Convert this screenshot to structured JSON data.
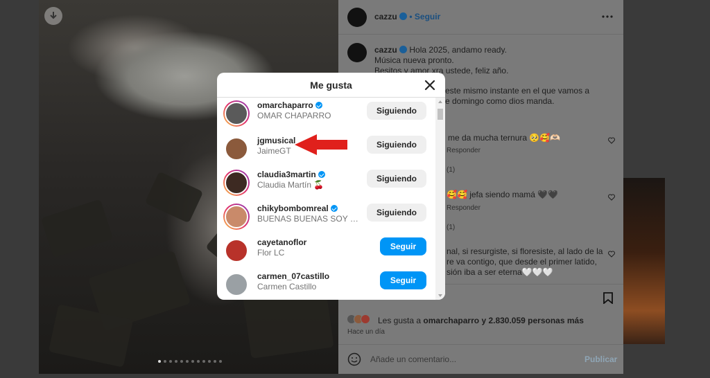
{
  "post": {
    "author": "cazzu",
    "follow_label": "Seguir",
    "caption_lines": [
      "Hola 2025, andamo ready.",
      "Música nueva pronto.",
      "Besitos y amor xra ustede, feliz año."
    ],
    "caption_prefix_author": "cazzu",
    "text_fragments": [
      "este mismo instante en el que vamos a",
      "e domingo como dios manda."
    ],
    "comments": [
      {
        "text": "me da mucha ternura 🥺🥰🫶🏻",
        "reply": "Responder",
        "count": "(1)"
      },
      {
        "text": "🥰🥰 jefa siendo mamá 🖤🖤",
        "reply": "Responder",
        "count": "(1)"
      },
      {
        "lines": [
          "nal, si resurgiste, si floresiste, al lado de la",
          "re va contigo, que desde el primer latido,",
          "sión iba a ser eterna🤍🤍🤍"
        ]
      }
    ],
    "likes_prefix": "Les gusta a",
    "likes_user": "omarchaparro",
    "likes_suffix": "y 2.830.059 personas más",
    "timestamp": "Hace un día",
    "comment_placeholder": "Añade un comentario...",
    "publish_label": "Publicar"
  },
  "modal": {
    "title": "Me gusta",
    "users": [
      {
        "username": "omarchaparro",
        "fullname": "OMAR CHAPARRO",
        "verified": true,
        "story": true,
        "button": "Siguiendo",
        "state": "following",
        "avatar_color": "#5a5a5a"
      },
      {
        "username": "jgmusical",
        "fullname": "JaimeGT",
        "verified": false,
        "story": false,
        "button": "Siguiendo",
        "state": "following",
        "avatar_color": "#8b5a3c"
      },
      {
        "username": "claudia3martin",
        "fullname": "Claudia Martín 🍒",
        "verified": true,
        "story": true,
        "button": "Siguiendo",
        "state": "following",
        "avatar_color": "#3d2a22"
      },
      {
        "username": "chikybombomreal",
        "fullname": "BUENAS BUENAS SOY CHI...",
        "verified": true,
        "story": true,
        "button": "Siguiendo",
        "state": "following",
        "avatar_color": "#c98a6a"
      },
      {
        "username": "cayetanoflor",
        "fullname": "Flor LC",
        "verified": false,
        "story": false,
        "button": "Seguir",
        "state": "follow",
        "avatar_color": "#b8322a"
      },
      {
        "username": "carmen_07castillo",
        "fullname": "Carmen Castillo",
        "verified": false,
        "story": false,
        "button": "Seguir",
        "state": "follow",
        "avatar_color": "#9aa0a4"
      }
    ]
  },
  "colors": {
    "accent": "#0095f6",
    "annotation_arrow": "#e0201c"
  },
  "icons": {
    "download": "download-icon",
    "close": "close-icon",
    "more": "more-icon",
    "bookmark": "bookmark-icon",
    "emoji": "emoji-icon"
  }
}
